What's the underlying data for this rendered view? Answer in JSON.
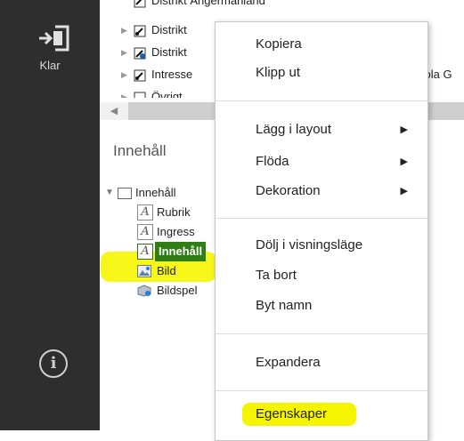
{
  "rail": {
    "done_label": "Klar",
    "exit_icon": "exit-icon",
    "info_icon": "info-icon",
    "info_glyph": "i"
  },
  "top_tree": {
    "items": [
      {
        "label": "Distrikt Ångermanland"
      },
      {
        "label": "Distrikt"
      },
      {
        "label": "Distrikt"
      },
      {
        "label": "Intresse",
        "suffix": "kola G"
      },
      {
        "label": "Övrigt"
      }
    ]
  },
  "section": {
    "title": "Innehåll"
  },
  "content_tree": {
    "root": "Innehåll",
    "items": [
      {
        "label": "Rubrik",
        "icon": "text-A-icon"
      },
      {
        "label": "Ingress",
        "icon": "text-A-icon"
      },
      {
        "label": "Innehåll",
        "icon": "text-A-icon",
        "selected": true
      },
      {
        "label": "Bild",
        "icon": "image-icon"
      },
      {
        "label": "Bildspel",
        "icon": "slideshow-icon"
      }
    ]
  },
  "menu": {
    "copy": "Kopiera",
    "cut": "Klipp ut",
    "add_to_layout": "Lägg i layout",
    "flow": "Flöda",
    "decoration": "Dekoration",
    "hide_in_view": "Dölj i visningsläge",
    "remove": "Ta bort",
    "rename": "Byt namn",
    "expand": "Expandera",
    "properties": "Egenskaper",
    "submenu_glyph": "▶"
  },
  "colors": {
    "rail": "#2e2e2e",
    "selected": "#2f7d14",
    "highlighter": "#f5f500"
  }
}
